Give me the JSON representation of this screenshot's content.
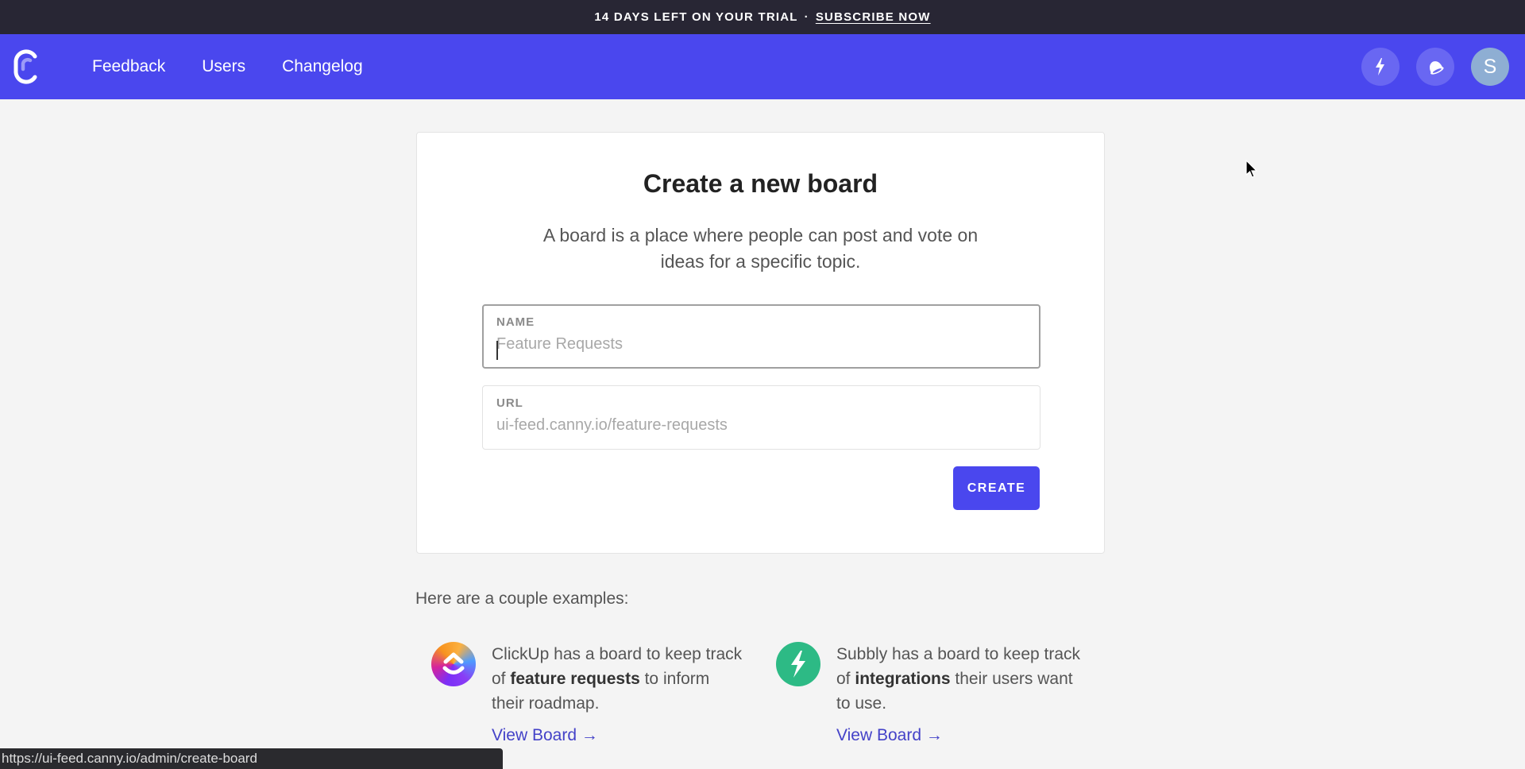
{
  "banner": {
    "trial_text": "14 DAYS LEFT ON YOUR TRIAL",
    "separator": "·",
    "subscribe_label": "SUBSCRIBE NOW"
  },
  "nav": {
    "logo_icon": "canny-logo-icon",
    "links": [
      {
        "label": "Feedback"
      },
      {
        "label": "Users"
      },
      {
        "label": "Changelog"
      }
    ],
    "actions": [
      {
        "icon": "lightning-bolt-icon"
      },
      {
        "icon": "bell-icon"
      }
    ],
    "avatar_initial": "S"
  },
  "card": {
    "title": "Create a new board",
    "description": "A board is a place where people can post and vote on ideas for a specific topic.",
    "name_field": {
      "label": "NAME",
      "value": "",
      "placeholder": "Feature Requests"
    },
    "url_field": {
      "label": "URL",
      "value": "",
      "placeholder": "ui-feed.canny.io/feature-requests"
    },
    "create_label": "CREATE"
  },
  "examples": {
    "heading": "Here are a couple examples:",
    "items": [
      {
        "company": "ClickUp",
        "text_before": "ClickUp has a board to keep track of ",
        "bold": "feature requests",
        "text_after": " to inform their roadmap.",
        "link_label": "View Board →"
      },
      {
        "company": "Subbly",
        "text_before": "Subbly has a board to keep track of ",
        "bold": "integrations",
        "text_after": " their users want to use.",
        "link_label": "View Board →"
      }
    ]
  },
  "status_bar": {
    "url": "https://ui-feed.canny.io/admin/create-board"
  },
  "colors": {
    "brand": "#4a47ee",
    "banner_bg": "#282634",
    "link": "#4442c8",
    "subbly_green": "#2dba85"
  }
}
